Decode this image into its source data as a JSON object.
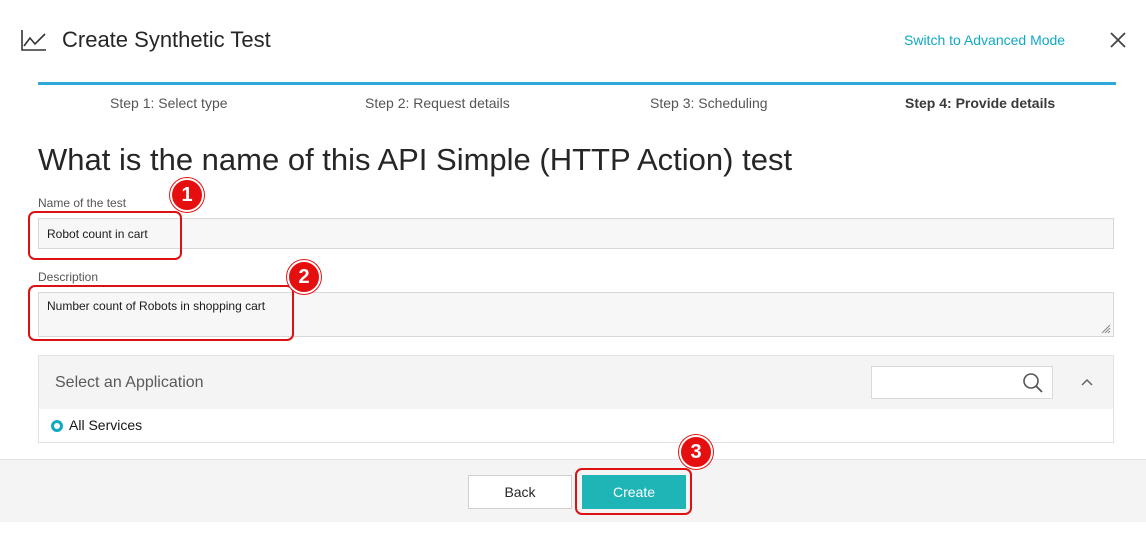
{
  "header": {
    "title": "Create Synthetic Test",
    "advanced_link": "Switch to Advanced Mode",
    "icons": {
      "chart": "line-chart-icon",
      "close": "close-icon"
    }
  },
  "steps": [
    {
      "label": "Step 1: Select type",
      "active": false
    },
    {
      "label": "Step 2: Request details",
      "active": false
    },
    {
      "label": "Step 3: Scheduling",
      "active": false
    },
    {
      "label": "Step 4: Provide details",
      "active": true
    }
  ],
  "question": "What is the name of this API Simple (HTTP Action) test",
  "form": {
    "name_label": "Name of the test",
    "name_value": "Robot count in cart",
    "description_label": "Description",
    "description_value": "Number count of Robots in shopping cart"
  },
  "application": {
    "title": "Select an Application",
    "search_value": "",
    "option_label": "All Services",
    "option_selected": true
  },
  "footer": {
    "back_label": "Back",
    "create_label": "Create"
  },
  "annotations": [
    "1",
    "2",
    "3"
  ],
  "colors": {
    "accent": "#10a9c4",
    "progress": "#30a8d8",
    "create_button": "#1fb5b7",
    "annotation": "#e60f0f"
  }
}
